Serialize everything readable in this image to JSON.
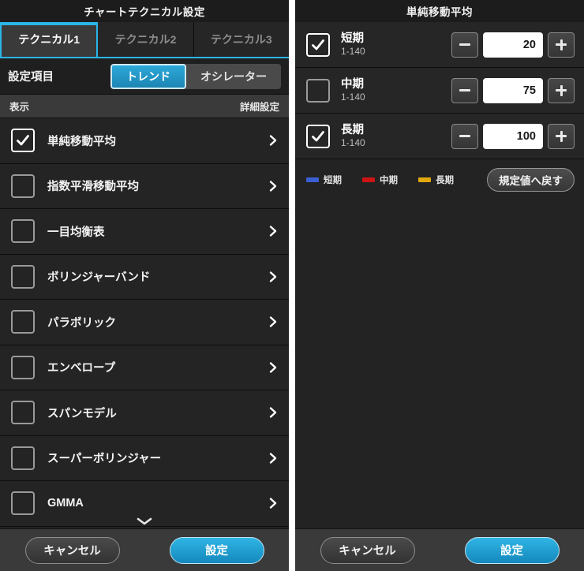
{
  "left_panel": {
    "title": "チャートテクニカル設定",
    "tabs": [
      {
        "label": "テクニカル1",
        "active": true
      },
      {
        "label": "テクニカル2",
        "active": false
      },
      {
        "label": "テクニカル3",
        "active": false
      }
    ],
    "setting_row": {
      "label": "設定項目",
      "options": [
        {
          "label": "トレンド",
          "active": true
        },
        {
          "label": "オシレーター",
          "active": false
        }
      ]
    },
    "list_header": {
      "left": "表示",
      "right": "詳細設定"
    },
    "items": [
      {
        "label": "単純移動平均",
        "checked": true
      },
      {
        "label": "指数平滑移動平均",
        "checked": false
      },
      {
        "label": "一目均衡表",
        "checked": false
      },
      {
        "label": "ボリンジャーバンド",
        "checked": false
      },
      {
        "label": "パラボリック",
        "checked": false
      },
      {
        "label": "エンベロープ",
        "checked": false
      },
      {
        "label": "スパンモデル",
        "checked": false
      },
      {
        "label": "スーパーボリンジャー",
        "checked": false
      },
      {
        "label": "GMMA",
        "checked": false
      }
    ],
    "scroll_hint_icon": "chevron-down-icon",
    "footer": {
      "cancel": "キャンセル",
      "confirm": "設定"
    }
  },
  "right_panel": {
    "title": "単純移動平均",
    "rows": [
      {
        "title": "短期",
        "range": "1-140",
        "value": "20",
        "checked": true
      },
      {
        "title": "中期",
        "range": "1-140",
        "value": "75",
        "checked": false
      },
      {
        "title": "長期",
        "range": "1-140",
        "value": "100",
        "checked": true
      }
    ],
    "legend": [
      {
        "label": "短期",
        "color": "#3b5fd4"
      },
      {
        "label": "中期",
        "color": "#cc1414"
      },
      {
        "label": "長期",
        "color": "#e0a80c"
      }
    ],
    "reset_label": "規定値へ戻す",
    "footer": {
      "cancel": "キャンセル",
      "confirm": "設定"
    }
  },
  "theme": {
    "accent": "#2ab6e8",
    "background": "#232323",
    "row_background": "#242424"
  }
}
